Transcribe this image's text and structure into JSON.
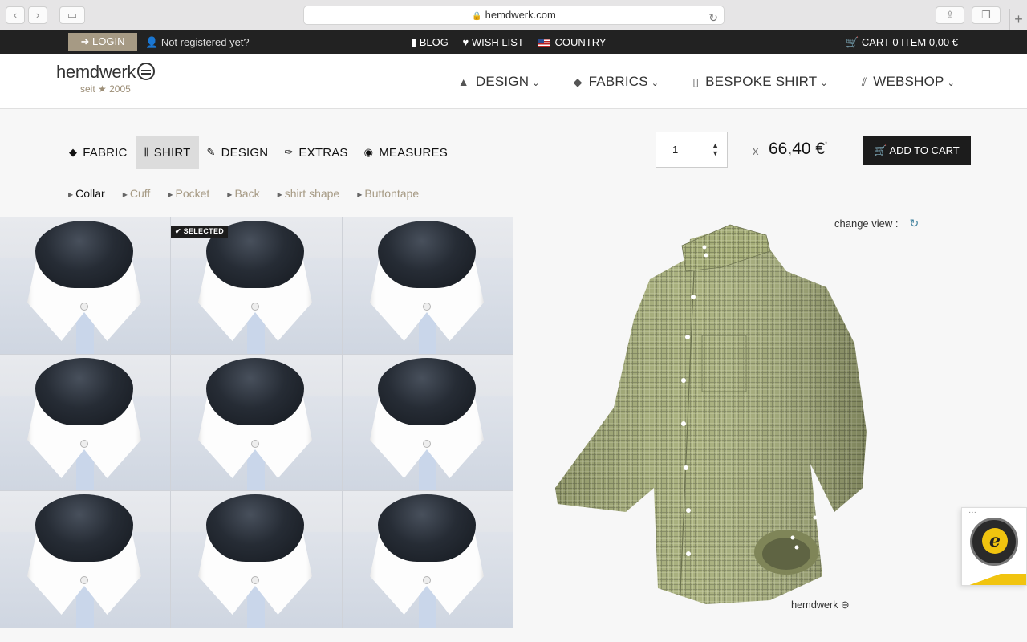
{
  "browser": {
    "url": "hemdwerk.com"
  },
  "topbar": {
    "login": "LOGIN",
    "not_registered": "Not registered yet?",
    "blog": "BLOG",
    "wishlist": "WISH LIST",
    "country": "COUNTRY",
    "cart": "CART 0 ITEM 0,00 €"
  },
  "header": {
    "logo": "hemdwerk",
    "logo_sub": "seit ★ 2005",
    "nav": [
      {
        "label": "DESIGN",
        "icon": "shirt-icon"
      },
      {
        "label": "FABRICS",
        "icon": "fabric-icon"
      },
      {
        "label": "BESPOKE SHIRT",
        "icon": "bespoke-icon"
      },
      {
        "label": "WEBSHOP",
        "icon": "tie-icon"
      }
    ]
  },
  "configurator": {
    "tabs": [
      {
        "label": "FABRIC",
        "icon": "fabric-icon",
        "active": false
      },
      {
        "label": "SHIRT",
        "icon": "shirt-icon",
        "active": true
      },
      {
        "label": "DESIGN",
        "icon": "design-icon",
        "active": false
      },
      {
        "label": "EXTRAS",
        "icon": "pin-icon",
        "active": false
      },
      {
        "label": "MEASURES",
        "icon": "tape-icon",
        "active": false
      }
    ],
    "subtabs": [
      {
        "label": "Collar",
        "active": true
      },
      {
        "label": "Cuff",
        "active": false
      },
      {
        "label": "Pocket",
        "active": false
      },
      {
        "label": "Back",
        "active": false
      },
      {
        "label": "shirt shape",
        "active": false
      },
      {
        "label": "Buttontape",
        "active": false
      }
    ],
    "quantity": "1",
    "times": "x",
    "price": "66,40 €",
    "price_note": "*",
    "add_to_cart": "ADD TO CART",
    "selected_badge": "SELECTED",
    "selected_index": 1,
    "collar_count": 9,
    "change_view": "change view :"
  },
  "preview": {
    "brand": "hemdwerk",
    "fabric_color": "#a5ad78"
  }
}
